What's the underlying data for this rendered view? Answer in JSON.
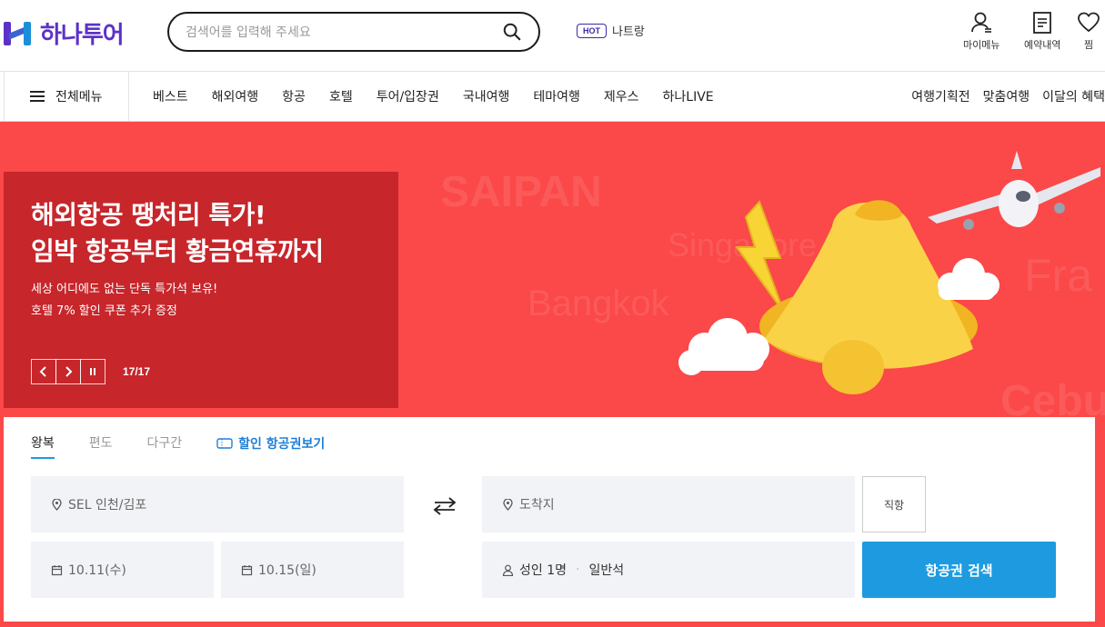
{
  "brand": {
    "name": "하나투어"
  },
  "search": {
    "placeholder": "검색어를 입력해 주세요"
  },
  "hot": {
    "badge": "HOT",
    "text": "나트랑"
  },
  "util": {
    "my": "마이메뉴",
    "booking": "예약내역",
    "wish": "찜"
  },
  "gnb": {
    "all_menu": "전체메뉴",
    "items": [
      "베스트",
      "해외여행",
      "항공",
      "호텔",
      "투어/입장권",
      "국내여행",
      "테마여행",
      "제우스",
      "하나LIVE"
    ],
    "right_items": [
      "여행기획전",
      "맞춤여행",
      "이달의 혜택"
    ]
  },
  "hero": {
    "title_line1": "해외항공 땡처리 특가!",
    "title_line2": "임박 항공부터 황금연휴까지",
    "desc_line1": "세상 어디에도 없는 단독 특가석 보유!",
    "desc_line2": "호텔 7% 할인 쿠폰 추가 증정",
    "pager": "17/17",
    "bg_words": [
      "SAIPAN",
      "Singapore",
      "Bangkok",
      "Fra",
      "Cebu"
    ]
  },
  "booking": {
    "tabs": [
      "왕복",
      "편도",
      "다구간"
    ],
    "discount_link": "할인 항공권보기",
    "departure": "SEL 인천/김포",
    "arrival": "도착지",
    "direct": "직항",
    "date_from": "10.11(수)",
    "date_to": "10.15(일)",
    "passengers": "성인 1명",
    "seat_class": "일반석",
    "search_button": "항공권 검색"
  },
  "colors": {
    "brand": "#5b32c8",
    "hero_bg": "#fb4848",
    "promo_bg": "#c7262b",
    "accent": "#1e9be0"
  }
}
